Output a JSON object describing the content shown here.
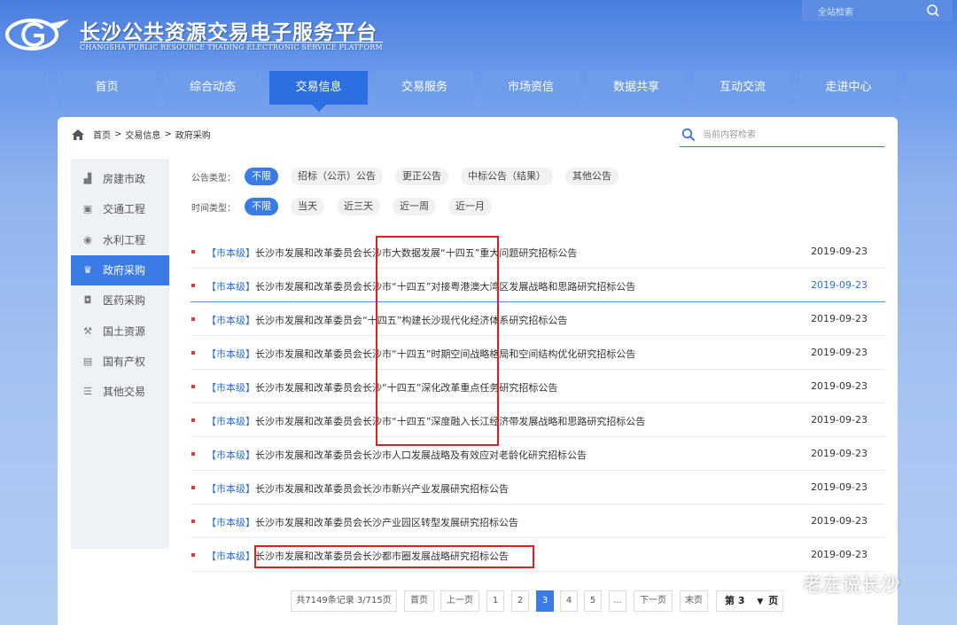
{
  "header": {
    "logo_cn": "长沙公共资源交易电子服务平台",
    "logo_en": "CHANGSHA PUBLIC RESOURCE TRADING ELECTRONIC SERVICE PLATFORM",
    "global_search_placeholder": "全站检索"
  },
  "nav": {
    "items": [
      {
        "label": "首页"
      },
      {
        "label": "综合动态"
      },
      {
        "label": "交易信息"
      },
      {
        "label": "交易服务"
      },
      {
        "label": "市场资信"
      },
      {
        "label": "数据共享"
      },
      {
        "label": "互动交流"
      },
      {
        "label": "走进中心"
      }
    ],
    "active": "交易信息"
  },
  "breadcrumb": {
    "home": "首页",
    "sep": ">",
    "level2": "交易信息",
    "level3": "政府采购"
  },
  "content_search": {
    "placeholder": "当前内容检索"
  },
  "sidebar": {
    "items": [
      {
        "label": "房建市政",
        "icon": "building-icon"
      },
      {
        "label": "交通工程",
        "icon": "bus-icon"
      },
      {
        "label": "水利工程",
        "icon": "water-icon"
      },
      {
        "label": "政府采购",
        "icon": "procurement-icon"
      },
      {
        "label": "医药采购",
        "icon": "medicine-icon"
      },
      {
        "label": "国土资源",
        "icon": "land-icon"
      },
      {
        "label": "国有产权",
        "icon": "property-icon"
      },
      {
        "label": "其他交易",
        "icon": "list-icon"
      }
    ],
    "active": "政府采购"
  },
  "filters": {
    "type_label": "公告类型：",
    "type_options": [
      "不限",
      "招标（公示）公告",
      "更正公告",
      "中标公告（结果）",
      "其他公告"
    ],
    "time_label": "时间类型：",
    "time_options": [
      "不限",
      "当天",
      "近三天",
      "近一周",
      "近一月"
    ]
  },
  "list": [
    {
      "tag": "【市本级】",
      "title": "长沙市发展和改革委员会长沙市大数据发展“十四五”重大问题研究招标公告",
      "date": "2019-09-23"
    },
    {
      "tag": "【市本级】",
      "title": "长沙市发展和改革委员会长沙市“十四五”对接粤港澳大湾区发展战略和思路研究招标公告",
      "date": "2019-09-23"
    },
    {
      "tag": "【市本级】",
      "title": "长沙市发展和改革委员会“十四五”构建长沙现代化经济体系研究招标公告",
      "date": "2019-09-23"
    },
    {
      "tag": "【市本级】",
      "title": "长沙市发展和改革委员会长沙市“十四五”时期空间战略格局和空间结构优化研究招标公告",
      "date": "2019-09-23"
    },
    {
      "tag": "【市本级】",
      "title": "长沙市发展和改革委员会长沙“十四五”深化改革重点任务研究招标公告",
      "date": "2019-09-23"
    },
    {
      "tag": "【市本级】",
      "title": "长沙市发展和改革委员会长沙市“十四五”深度融入长江经济带发展战略和思路研究招标公告",
      "date": "2019-09-23"
    },
    {
      "tag": "【市本级】",
      "title": "长沙市发展和改革委员会长沙市人口发展战略及有效应对老龄化研究招标公告",
      "date": "2019-09-23"
    },
    {
      "tag": "【市本级】",
      "title": "长沙市发展和改革委员会长沙市新兴产业发展研究招标公告",
      "date": "2019-09-23"
    },
    {
      "tag": "【市本级】",
      "title": "长沙市发展和改革委员会长沙产业园区转型发展研究招标公告",
      "date": "2019-09-23"
    },
    {
      "tag": "【市本级】",
      "title": "长沙市发展和改革委员会长沙都市圈发展战略研究招标公告",
      "date": "2019-09-23"
    }
  ],
  "pagination": {
    "summary": "共7149条记录 3/715页",
    "first": "首页",
    "prev": "上一页",
    "pages": [
      "1",
      "2",
      "3",
      "4",
      "5",
      "..."
    ],
    "current": "3",
    "next": "下一页",
    "last": "末页",
    "jump": "第 3",
    "jump_unit": "页"
  },
  "watermark": {
    "text": "老左说长沙"
  },
  "colors": {
    "accent": "#3a7be6",
    "nav_bg": "#6f9de9",
    "nav_active": "#2c6fe0",
    "annotation": "#e02020",
    "bullet": "#e03a3a"
  }
}
